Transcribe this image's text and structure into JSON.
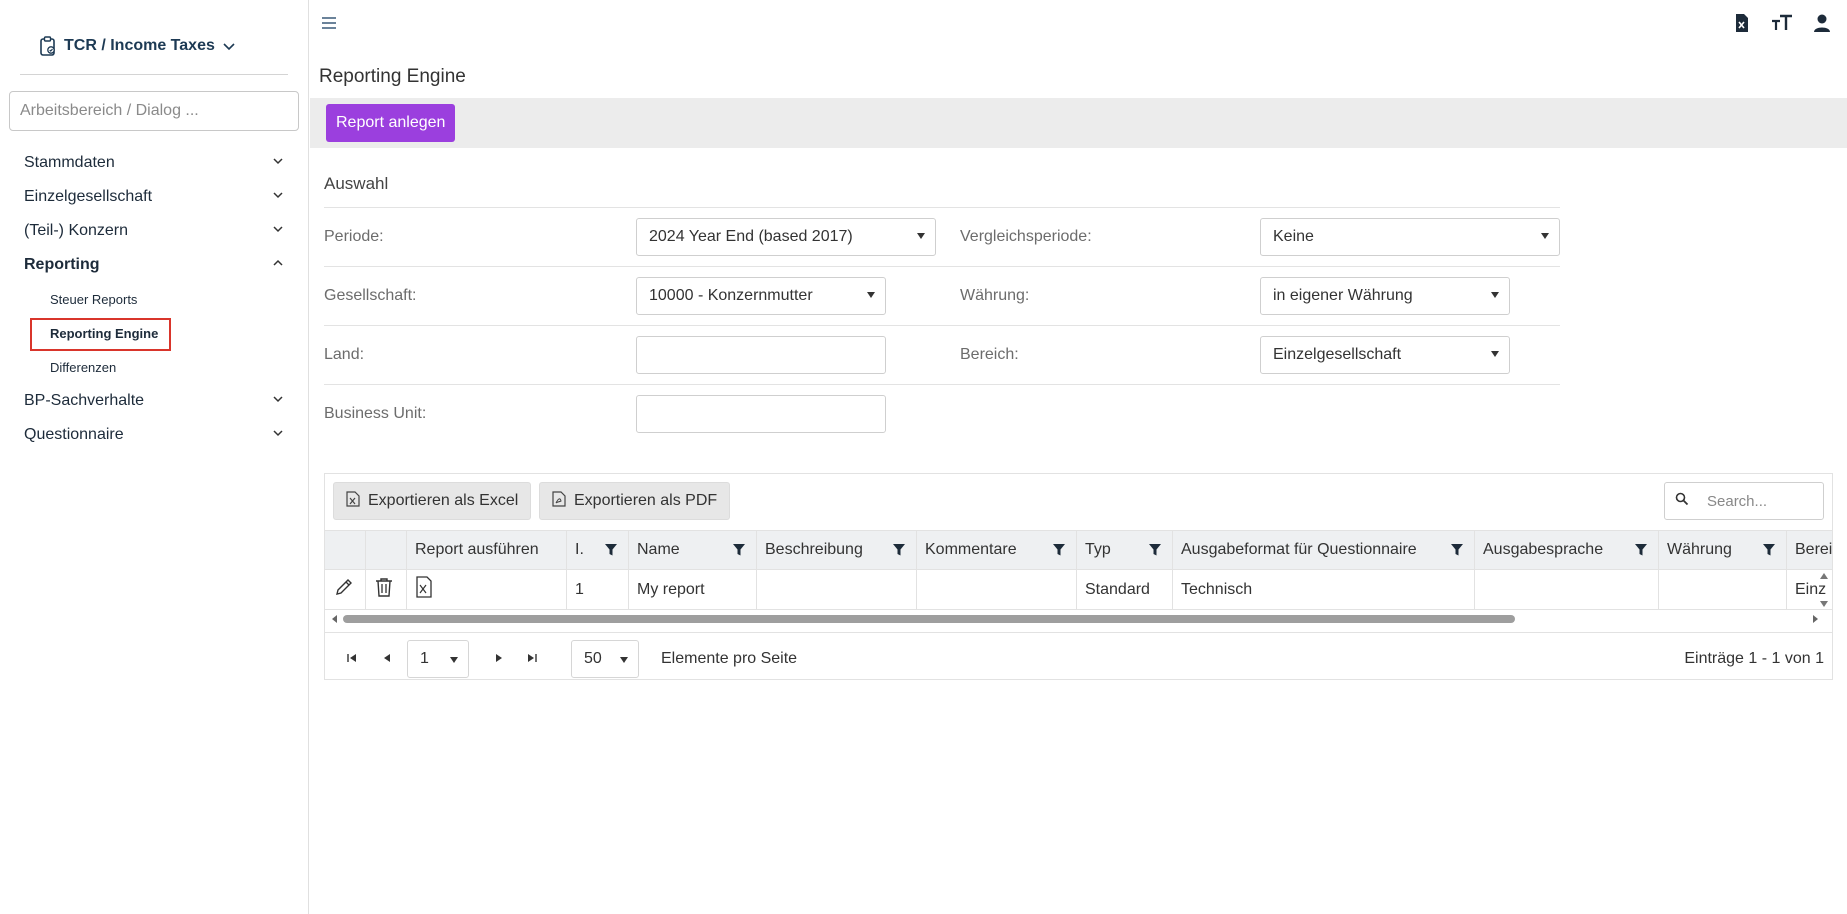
{
  "sidebar": {
    "workspace": "TCR / Income Taxes",
    "search_placeholder": "Arbeitsbereich / Dialog ...",
    "items": [
      {
        "label": "Stammdaten"
      },
      {
        "label": "Einzelgesellschaft"
      },
      {
        "label": "(Teil-) Konzern"
      },
      {
        "label": "Reporting"
      },
      {
        "label": "BP-Sachverhalte"
      },
      {
        "label": "Questionnaire"
      }
    ],
    "reporting_children": [
      "Steuer Reports",
      "Reporting Engine",
      "Differenzen"
    ]
  },
  "header": {
    "title": "Reporting Engine",
    "create_button": "Report anlegen"
  },
  "form": {
    "section_title": "Auswahl",
    "periode_label": "Periode:",
    "periode_value": "2024 Year End (based 2017)",
    "vergleich_label": "Vergleichsperiode:",
    "vergleich_value": "Keine",
    "gesellschaft_label": "Gesellschaft:",
    "gesellschaft_value": "10000 - Konzernmutter",
    "waehrung_label": "Währung:",
    "waehrung_value": "in eigener Währung",
    "land_label": "Land:",
    "land_value": "",
    "bereich_label": "Bereich:",
    "bereich_value": "Einzelgesellschaft",
    "bu_label": "Business Unit:",
    "bu_value": ""
  },
  "grid": {
    "export_excel": "Exportieren als Excel",
    "export_pdf": "Exportieren als PDF",
    "search_placeholder": "Search...",
    "columns": [
      "",
      "",
      "Report ausführen",
      "I.",
      "Name",
      "Beschreibung",
      "Kommentare",
      "Typ",
      "Ausgabeformat für Questionnaire",
      "Ausgabesprache",
      "Währung",
      "Berei"
    ],
    "rows": [
      {
        "id": "1",
        "name": "My report",
        "beschreibung": "",
        "kommentare": "",
        "typ": "Standard",
        "ausgabeformat": "Technisch",
        "ausgabesprache": "",
        "waehrung": "",
        "bereich": "Einz"
      }
    ],
    "pager": {
      "page": "1",
      "page_size": "50",
      "page_size_label": "Elemente pro Seite",
      "summary": "Einträge 1 - 1 von 1"
    }
  },
  "colors": {
    "accent": "#9b3fde",
    "highlight_border": "#d9352b",
    "nav_text": "#1d2b3a"
  }
}
